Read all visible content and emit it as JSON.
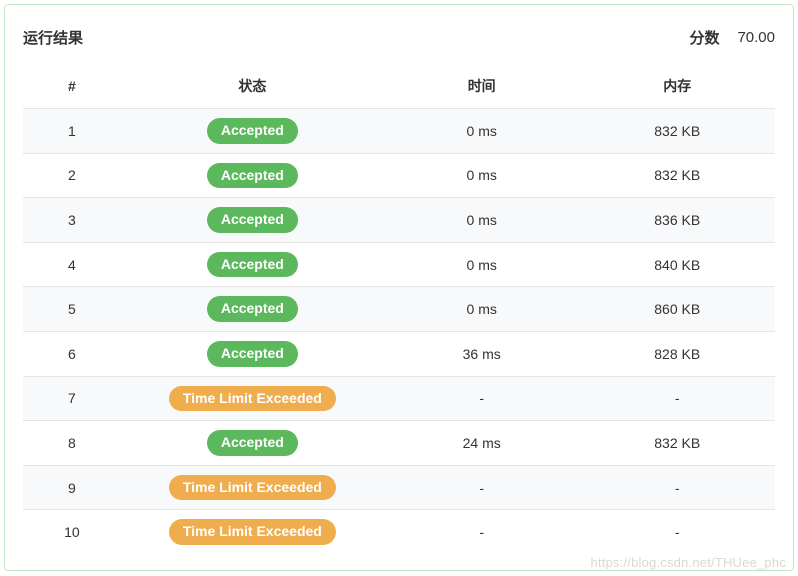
{
  "header": {
    "title": "运行结果",
    "score_label": "分数",
    "score_value": "70.00"
  },
  "columns": {
    "num": "#",
    "status": "状态",
    "time": "时间",
    "memory": "内存"
  },
  "status_labels": {
    "Accepted": "Accepted",
    "TimeLimitExceeded": "Time Limit Exceeded"
  },
  "status_colors": {
    "Accepted": "#5cb85c",
    "TimeLimitExceeded": "#f0ad4e"
  },
  "rows": [
    {
      "num": "1",
      "status": "Accepted",
      "time": "0 ms",
      "memory": "832 KB"
    },
    {
      "num": "2",
      "status": "Accepted",
      "time": "0 ms",
      "memory": "832 KB"
    },
    {
      "num": "3",
      "status": "Accepted",
      "time": "0 ms",
      "memory": "836 KB"
    },
    {
      "num": "4",
      "status": "Accepted",
      "time": "0 ms",
      "memory": "840 KB"
    },
    {
      "num": "5",
      "status": "Accepted",
      "time": "0 ms",
      "memory": "860 KB"
    },
    {
      "num": "6",
      "status": "Accepted",
      "time": "36 ms",
      "memory": "828 KB"
    },
    {
      "num": "7",
      "status": "TimeLimitExceeded",
      "time": "-",
      "memory": "-"
    },
    {
      "num": "8",
      "status": "Accepted",
      "time": "24 ms",
      "memory": "832 KB"
    },
    {
      "num": "9",
      "status": "TimeLimitExceeded",
      "time": "-",
      "memory": "-"
    },
    {
      "num": "10",
      "status": "TimeLimitExceeded",
      "time": "-",
      "memory": "-"
    }
  ],
  "watermark": "https://blog.csdn.net/THUee_phc"
}
